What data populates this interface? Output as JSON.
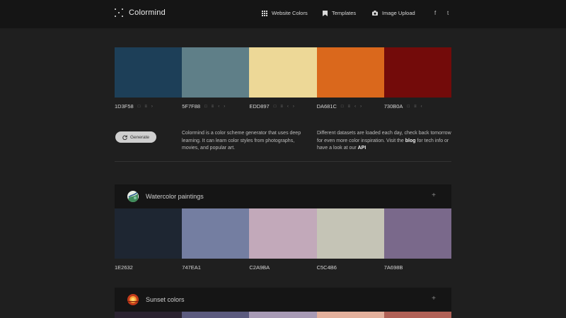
{
  "header": {
    "logo_text": "Colormind",
    "nav": [
      {
        "label": "Website Colors",
        "icon": "grid-icon"
      },
      {
        "label": "Templates",
        "icon": "bookmark-icon"
      },
      {
        "label": "Image Upload",
        "icon": "camera-icon"
      }
    ],
    "social": [
      "f",
      "t"
    ]
  },
  "main_palette": {
    "colors": [
      "#1D3F58",
      "#5F7F88",
      "#EDD897",
      "#DA681C",
      "#730B0A"
    ],
    "codes": [
      "1D3F58",
      "5F7F88",
      "EDD897",
      "DA681C",
      "730B0A"
    ]
  },
  "generate_button": {
    "label": "Generate"
  },
  "description": {
    "left": "Colormind is a color scheme generator that uses deep learning. It can learn color styles from photographs, movies, and popular art.",
    "right_1": "Different datasets are loaded each day, check back tomorrow for even more color inspiration. Visit the",
    "link_blog": "blog",
    "right_2": "for tech info or have a look at our",
    "link_api": "API"
  },
  "sections": [
    {
      "title": "Watercolor paintings",
      "colors": [
        "#1E2632",
        "#747EA1",
        "#C2A9BA",
        "#C5C4B6",
        "#7A698B"
      ],
      "codes": [
        "1E2632",
        "747EA1",
        "C2A9BA",
        "C5C4B6",
        "7A698B"
      ]
    },
    {
      "title": "Sunset colors",
      "colors": [
        "#2A2230",
        "#5B5A7E",
        "#A79AB5",
        "#E3B09C",
        "#B06156"
      ]
    }
  ],
  "icons": {
    "plus": "+",
    "lock": "🔒",
    "adjust": "≡",
    "left": "‹",
    "right": "›"
  }
}
